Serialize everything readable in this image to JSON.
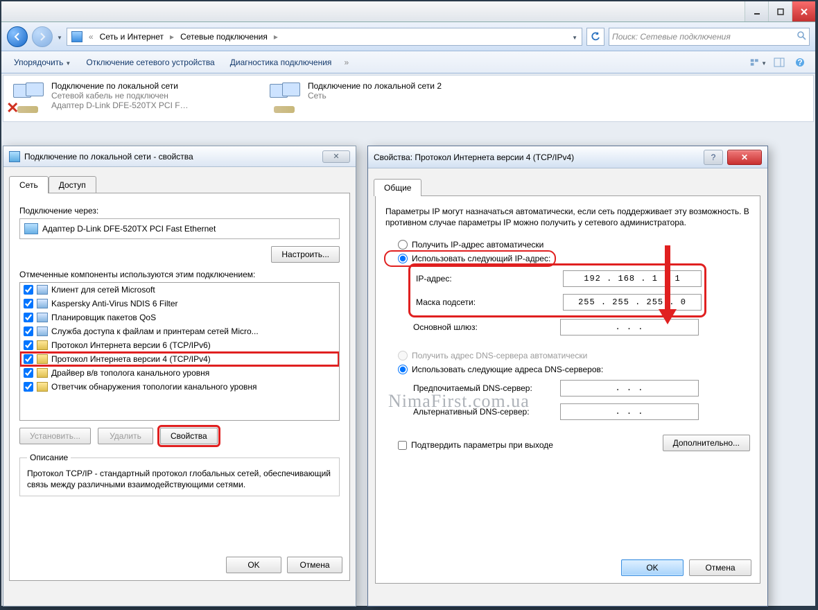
{
  "explorer": {
    "breadcrumb": {
      "seg1": "Сеть и Интернет",
      "seg2": "Сетевые подключения"
    },
    "search_placeholder": "Поиск: Сетевые подключения",
    "toolbar": {
      "organize": "Упорядочить",
      "disable": "Отключение сетевого устройства",
      "diagnose": "Диагностика подключения"
    },
    "conn1": {
      "title": "Подключение по локальной сети",
      "sub1": "Сетевой кабель не подключен",
      "sub2": "Адаптер D-Link DFE-520TX PCI F…"
    },
    "conn2": {
      "title": "Подключение по локальной сети 2",
      "sub1": "Сеть"
    }
  },
  "props": {
    "title": "Подключение по локальной сети - свойства",
    "tab_net": "Сеть",
    "tab_access": "Доступ",
    "connect_via": "Подключение через:",
    "adapter": "Адаптер D-Link DFE-520TX PCI Fast Ethernet",
    "configure": "Настроить...",
    "components_label": "Отмеченные компоненты используются этим подключением:",
    "components": [
      "Клиент для сетей Microsoft",
      "Kaspersky Anti-Virus NDIS 6 Filter",
      "Планировщик пакетов QoS",
      "Служба доступа к файлам и принтерам сетей Micro...",
      "Протокол Интернета версии 6 (TCP/IPv6)",
      "Протокол Интернета версии 4 (TCP/IPv4)",
      "Драйвер в/в тополога канального уровня",
      "Ответчик обнаружения топологии канального уровня"
    ],
    "install": "Установить...",
    "remove": "Удалить",
    "properties": "Свойства",
    "desc_legend": "Описание",
    "desc_text": "Протокол TCP/IP - стандартный протокол глобальных сетей, обеспечивающий связь между различными взаимодействующими сетями.",
    "ok": "OK",
    "cancel": "Отмена"
  },
  "ip": {
    "title": "Свойства: Протокол Интернета версии 4 (TCP/IPv4)",
    "tab_general": "Общие",
    "info": "Параметры IP могут назначаться автоматически, если сеть поддерживает эту возможность. В противном случае параметры IP можно получить у сетевого администратора.",
    "r_auto_ip": "Получить IP-адрес автоматически",
    "r_manual_ip": "Использовать следующий IP-адрес:",
    "lbl_ip": "IP-адрес:",
    "val_ip": "192 . 168 .  1  .  1",
    "lbl_mask": "Маска подсети:",
    "val_mask": "255 . 255 . 255 .  0",
    "lbl_gw": "Основной шлюз:",
    "val_gw": ".       .       .",
    "r_auto_dns": "Получить адрес DNS-сервера автоматически",
    "r_manual_dns": "Использовать следующие адреса DNS-серверов:",
    "lbl_dns1": "Предпочитаемый DNS-сервер:",
    "lbl_dns2": "Альтернативный DNS-сервер:",
    "val_dns_empty": ".       .       .",
    "confirm": "Подтвердить параметры при выходе",
    "advanced": "Дополнительно...",
    "ok": "OK",
    "cancel": "Отмена"
  },
  "watermark": "NimaFirst.com.ua"
}
